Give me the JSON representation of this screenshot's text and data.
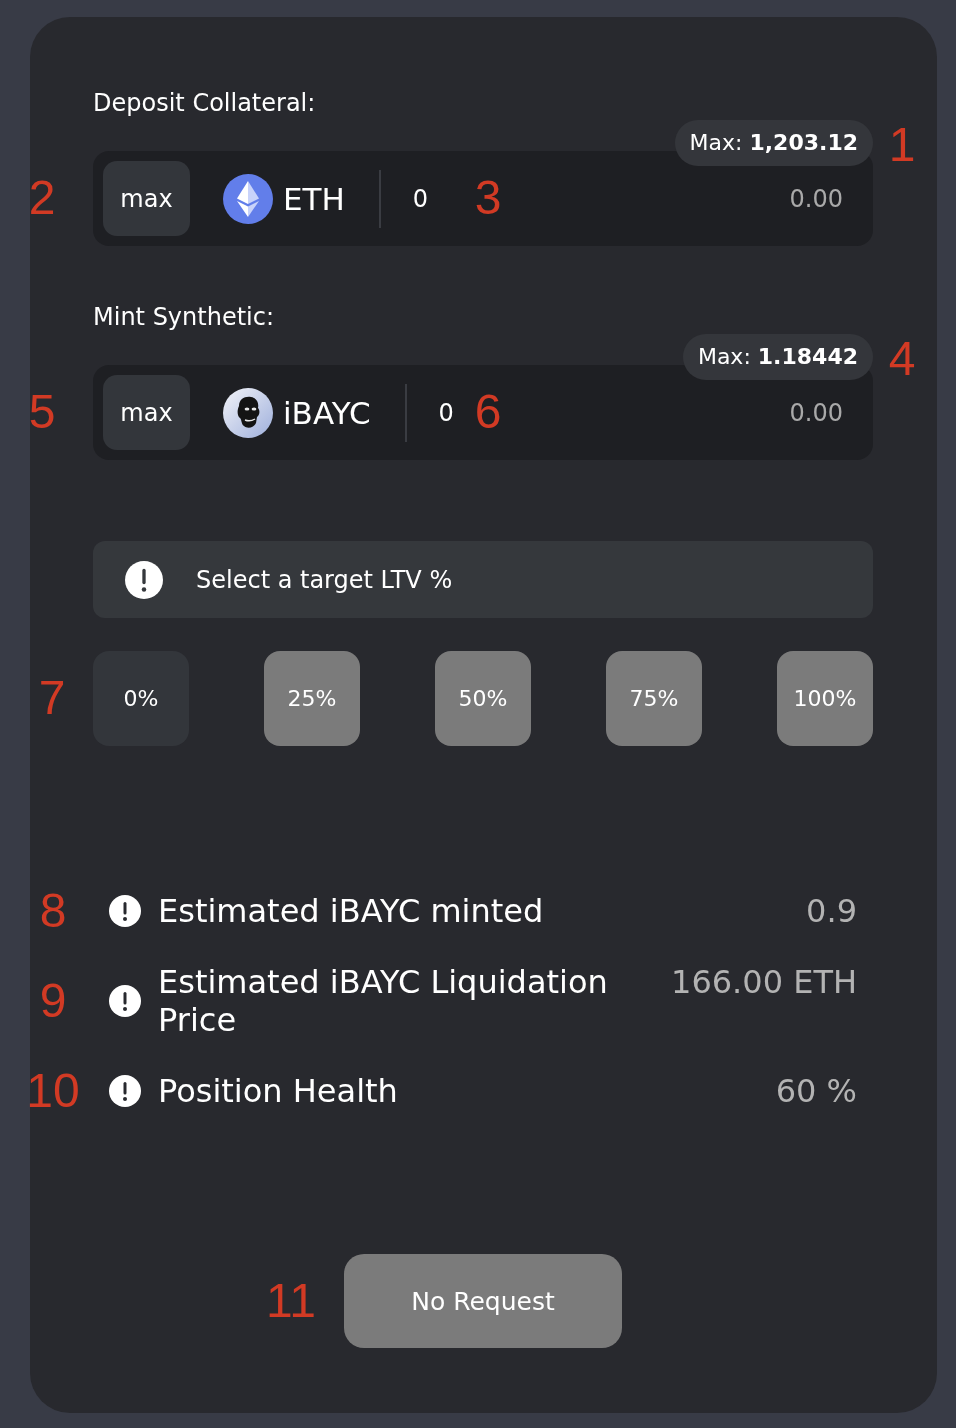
{
  "sections": [
    {
      "label": "Deposit Collateral:",
      "max_badge": {
        "text": "Max: **1,203.12**",
        "callout": "1"
      },
      "max_button": {
        "label": "max",
        "callout": "2"
      },
      "token": {
        "kind": "eth",
        "symbol": "ETH"
      },
      "amount": {
        "value": "0",
        "callout": "3"
      },
      "display_value": "0.00"
    },
    {
      "label": "Mint Synthetic:",
      "max_badge": {
        "text": "Max: **1.18442**",
        "callout": "4"
      },
      "max_button": {
        "label": "max",
        "callout": "5"
      },
      "token": {
        "kind": "ape",
        "symbol": "iBAYC"
      },
      "amount": {
        "value": "0",
        "callout": "6"
      },
      "display_value": "0.00"
    }
  ],
  "ltv": {
    "message": "Select a target LTV %",
    "callout": "7",
    "options": [
      {
        "label": "0%",
        "selected": true
      },
      {
        "label": "25%",
        "selected": false
      },
      {
        "label": "50%",
        "selected": false
      },
      {
        "label": "75%",
        "selected": false
      },
      {
        "label": "100%",
        "selected": false
      }
    ]
  },
  "stats": [
    {
      "label": "Estimated iBAYC minted",
      "value": "0.9",
      "callout": "8"
    },
    {
      "label": "Estimated iBAYC Liquidation Price",
      "value": "166.00 ETH",
      "callout": "9"
    },
    {
      "label": "Position Health",
      "value": "60 %",
      "callout": "10"
    }
  ],
  "submit": {
    "label": "No Request",
    "disabled": true,
    "callout": "11"
  }
}
